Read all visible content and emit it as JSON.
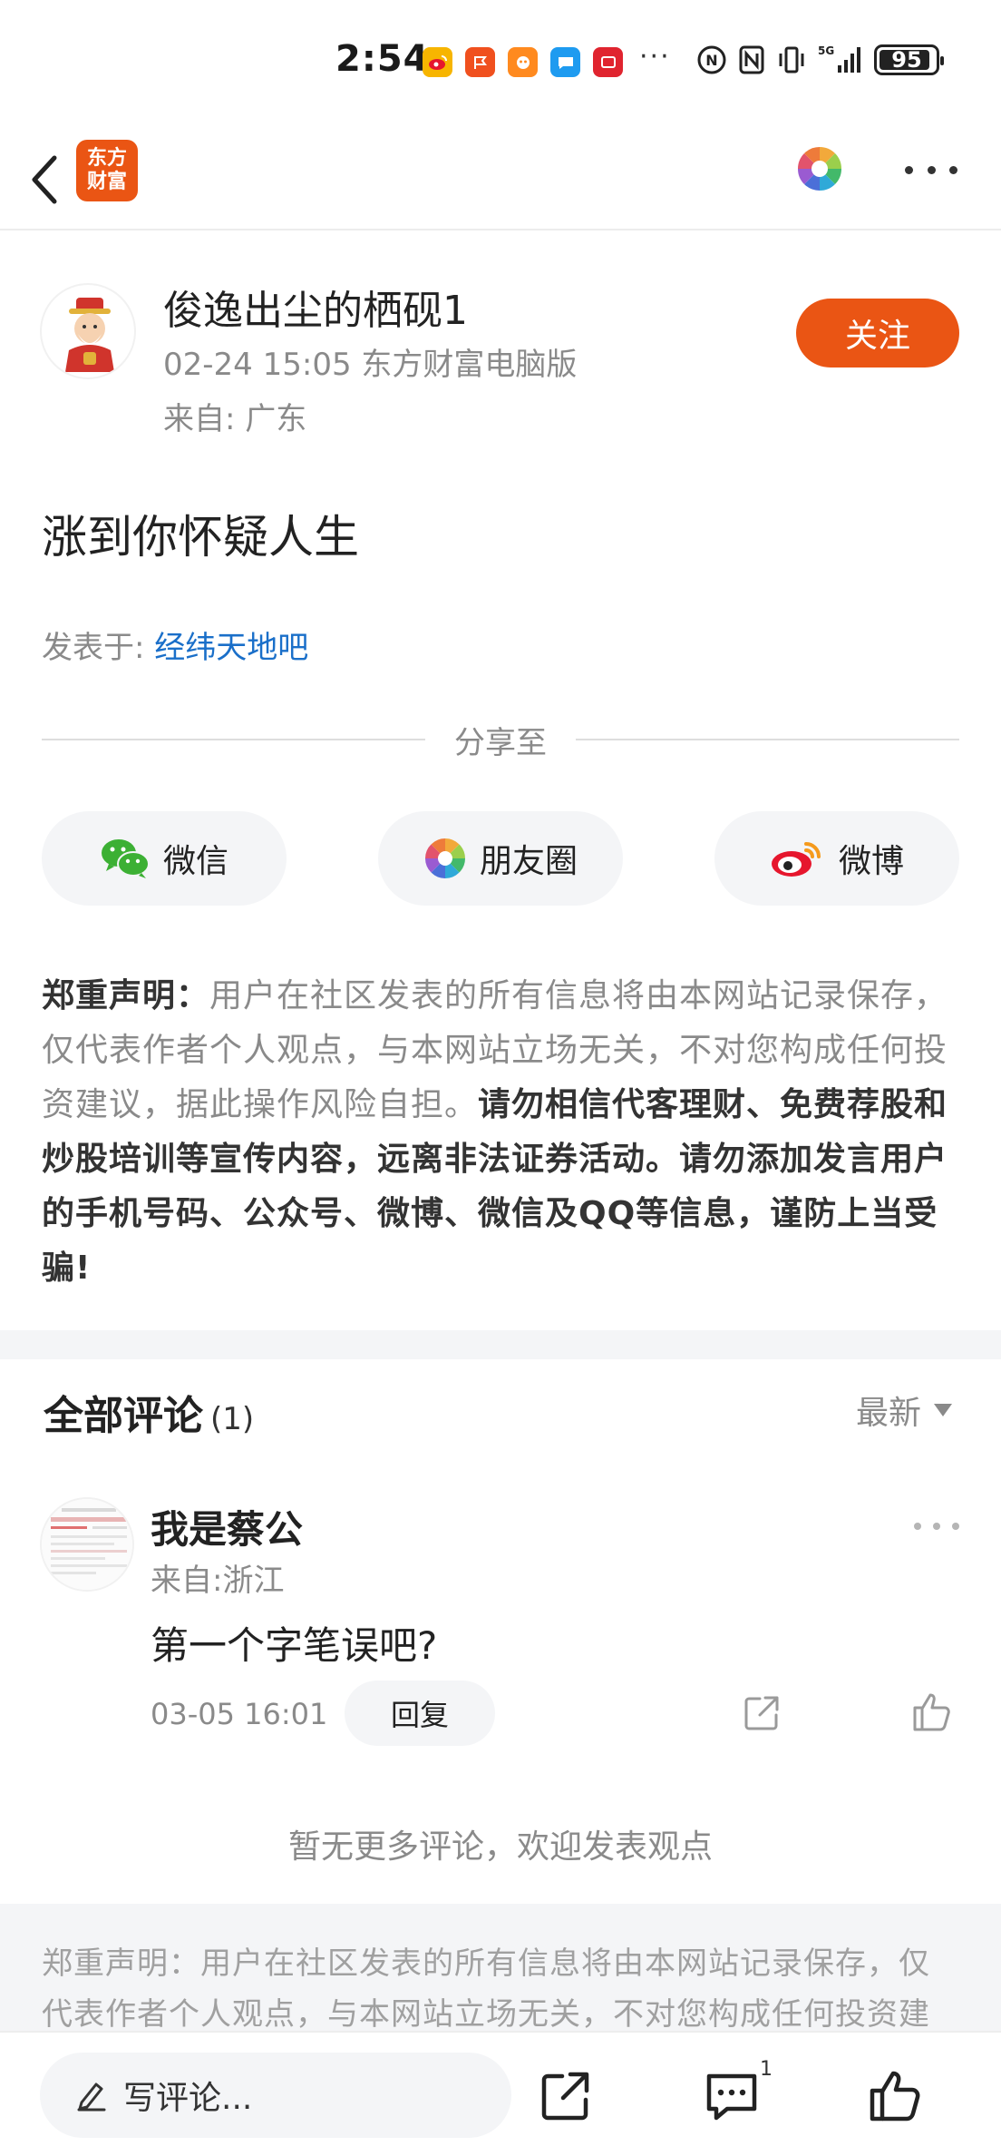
{
  "status_bar": {
    "time": "2:54",
    "dots": "···",
    "battery": "95",
    "network": "5G"
  },
  "nav": {
    "logo_line1": "东方",
    "logo_line2": "财富"
  },
  "author": {
    "name": "俊逸出尘的栖砚1",
    "meta": "02-24 15:05 东方财富电脑版",
    "location": "来自: 广东",
    "follow_label": "关注"
  },
  "post": {
    "title": "涨到你怀疑人生",
    "posted_in_prefix": "发表于: ",
    "bar_name": "经纬天地吧"
  },
  "share": {
    "heading": "分享至",
    "wechat": "微信",
    "moments": "朋友圈",
    "weibo": "微博"
  },
  "disclaimer": {
    "label": "郑重声明",
    "colon": "：",
    "part1": "用户在社区发表的所有信息将由本网站记录保存，仅代表作者个人观点，与本网站立场无关，不对您构成任何投资建议，据此操作风险自担。",
    "part2": "请勿相信代客理财、免费荐股和炒股培训等宣传内容，远离非法证券活动。请勿添加发言用户的手机号码、公众号、微博、微信及QQ等信息，谨防上当受骗!"
  },
  "comments": {
    "title": "全部评论",
    "count": "(1)",
    "sort_label": "最新",
    "items": [
      {
        "user": "我是蔡公",
        "location": "来自:浙江",
        "text": "第一个字笔误吧?",
        "time": "03-05 16:01",
        "reply_label": "回复"
      }
    ],
    "no_more": "暂无更多评论，欢迎发表观点"
  },
  "footer_disclaimer": "郑重声明：用户在社区发表的所有信息将由本网站记录保存，仅代表作者个人观点，与本网站立场无关，不对您构成任何投资建",
  "bottom_bar": {
    "input_placeholder": "写评论...",
    "comment_badge": "1"
  },
  "colors": {
    "brand_orange": "#ea5514",
    "link_blue": "#1a6fc9",
    "muted_text": "#8a8a8a",
    "pill_bg": "#f4f5f7"
  }
}
